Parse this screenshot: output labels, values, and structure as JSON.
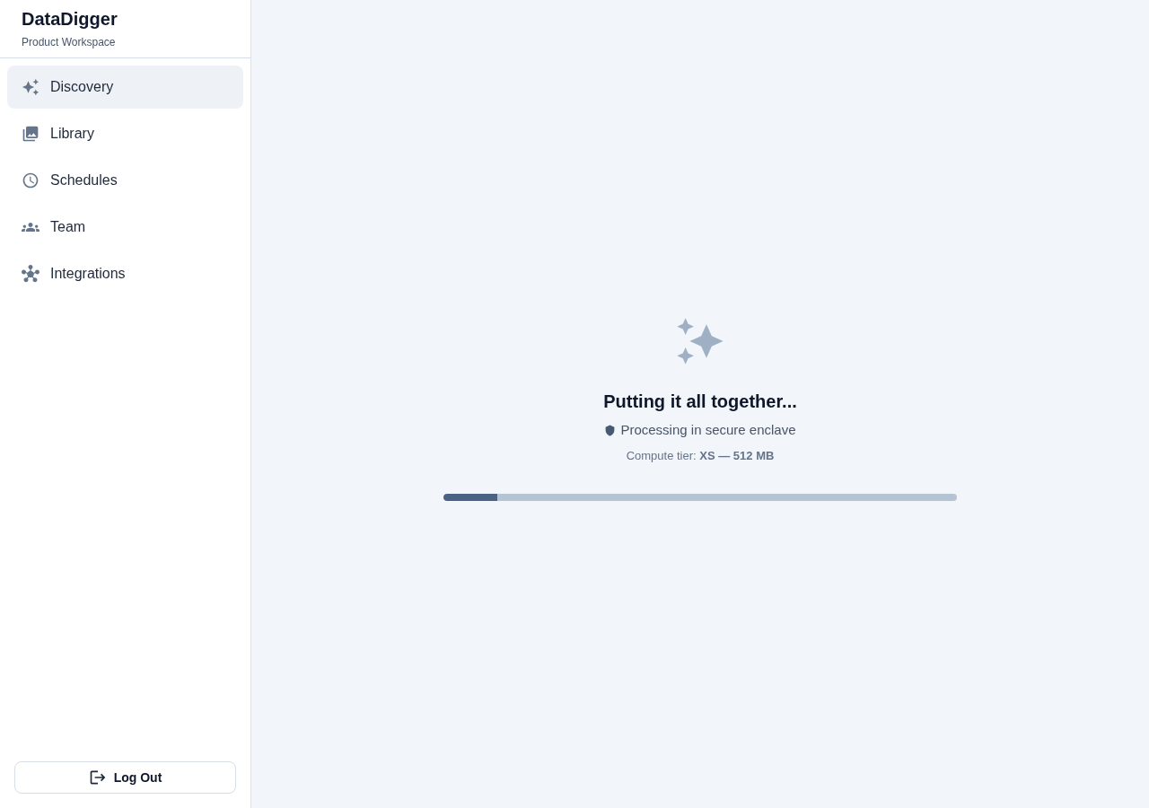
{
  "sidebar": {
    "brand": {
      "title": "DataDigger",
      "subtitle": "Product Workspace"
    },
    "nav_items": [
      {
        "label": "Discovery",
        "selected": true
      },
      {
        "label": "Library",
        "selected": false
      },
      {
        "label": "Schedules",
        "selected": false
      },
      {
        "label": "Team",
        "selected": false
      },
      {
        "label": "Integrations",
        "selected": false
      }
    ],
    "logout_button": {
      "label": "Log Out"
    }
  },
  "main": {
    "status": {
      "title": "Putting it all together...",
      "note": "Processing in secure enclave",
      "tier": "Compute tier: **XS — 512 MB**",
      "progress": {
        "level": 0.105
      }
    }
  }
}
